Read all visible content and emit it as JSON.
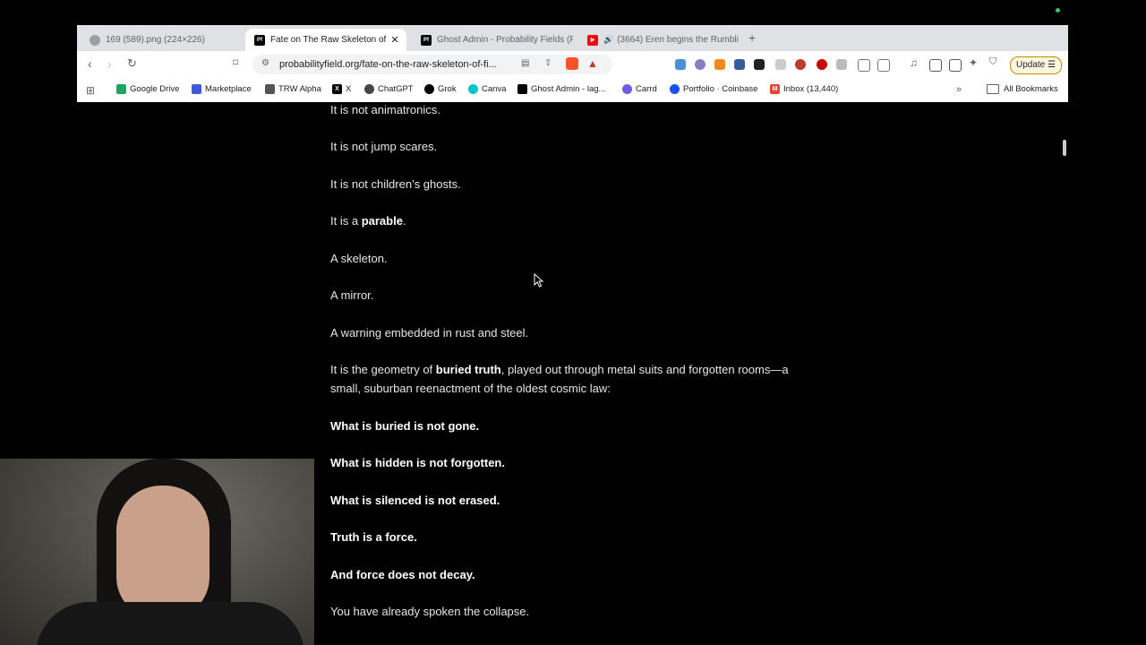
{
  "tabs": [
    {
      "title": "169 (589).png (224×226)",
      "active": false
    },
    {
      "title": "Fate on The Raw Skeleton of F",
      "active": true
    },
    {
      "title": "Ghost Admin - Probability Fields (P",
      "active": false
    },
    {
      "title": "(3664) Eren begins the Rumbli",
      "active": false
    }
  ],
  "toolbar": {
    "url": "probabilityfield.org/fate-on-the-raw-skeleton-of-fi...",
    "update_label": "Update",
    "brave_badge": "4"
  },
  "bookmarks": [
    {
      "label": "Google Drive"
    },
    {
      "label": "Marketplace"
    },
    {
      "label": "TRW Alpha"
    },
    {
      "label": "X"
    },
    {
      "label": "ChatGPT"
    },
    {
      "label": "Grok"
    },
    {
      "label": "Canva"
    },
    {
      "label": "Ghost Admin - lag..."
    },
    {
      "label": "Carrd"
    },
    {
      "label": "Portfolio · Coinbase"
    },
    {
      "label": "Inbox (13,440)"
    }
  ],
  "all_bookmarks_label": "All Bookmarks",
  "article": {
    "p1": "It is not animatronics.",
    "p2": "It is not jump scares.",
    "p3": "It is not children’s ghosts.",
    "p4_pre": "It is a ",
    "p4_bold": "parable",
    "p4_post": ".",
    "p5": "A skeleton.",
    "p6": "A mirror.",
    "p7": "A warning embedded in rust and steel.",
    "p8_pre": "It is the geometry of ",
    "p8_bold": "buried truth",
    "p8_post": ", played out through metal suits and forgotten rooms—a small, suburban reenactment of the oldest cosmic law:",
    "b1": "What is buried is not gone.",
    "b2": "What is hidden is not forgotten.",
    "b3": "What is silenced is not erased.",
    "b4": "Truth is a force.",
    "b5": "And force does not decay.",
    "p9": "You have already spoken the collapse."
  }
}
